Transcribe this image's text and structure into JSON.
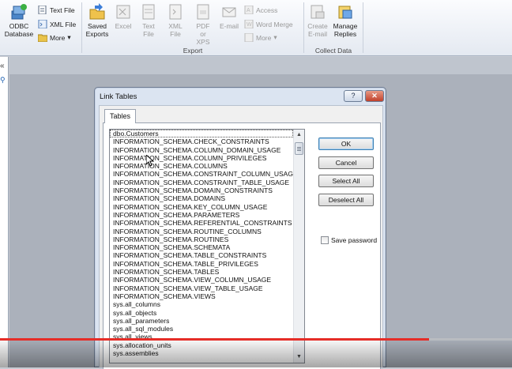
{
  "ribbon": {
    "import_group": {
      "odbc_label": "ODBC Database",
      "text_file": "Text File",
      "xml_file": "XML File",
      "more": "More"
    },
    "export_group": {
      "saved_exports": "Saved Exports",
      "excel": "Excel",
      "text_file": "Text File",
      "xml_file": "XML File",
      "pdf_xps": "PDF or XPS",
      "email": "E-mail",
      "access": "Access",
      "word_merge": "Word Merge",
      "more": "More",
      "label": "Export"
    },
    "collect_group": {
      "create_email": "Create E-mail",
      "manage_replies": "Manage Replies",
      "label": "Collect Data"
    }
  },
  "nav": {
    "collapse_glyph": "«",
    "search_glyph": "⚲"
  },
  "dialog": {
    "title": "Link Tables",
    "help_glyph": "?",
    "close_glyph": "✕",
    "tab": "Tables",
    "tables": [
      "dbo.Customers",
      "INFORMATION_SCHEMA.CHECK_CONSTRAINTS",
      "INFORMATION_SCHEMA.COLUMN_DOMAIN_USAGE",
      "INFORMATION_SCHEMA.COLUMN_PRIVILEGES",
      "INFORMATION_SCHEMA.COLUMNS",
      "INFORMATION_SCHEMA.CONSTRAINT_COLUMN_USAGE",
      "INFORMATION_SCHEMA.CONSTRAINT_TABLE_USAGE",
      "INFORMATION_SCHEMA.DOMAIN_CONSTRAINTS",
      "INFORMATION_SCHEMA.DOMAINS",
      "INFORMATION_SCHEMA.KEY_COLUMN_USAGE",
      "INFORMATION_SCHEMA.PARAMETERS",
      "INFORMATION_SCHEMA.REFERENTIAL_CONSTRAINTS",
      "INFORMATION_SCHEMA.ROUTINE_COLUMNS",
      "INFORMATION_SCHEMA.ROUTINES",
      "INFORMATION_SCHEMA.SCHEMATA",
      "INFORMATION_SCHEMA.TABLE_CONSTRAINTS",
      "INFORMATION_SCHEMA.TABLE_PRIVILEGES",
      "INFORMATION_SCHEMA.TABLES",
      "INFORMATION_SCHEMA.VIEW_COLUMN_USAGE",
      "INFORMATION_SCHEMA.VIEW_TABLE_USAGE",
      "INFORMATION_SCHEMA.VIEWS",
      "sys.all_columns",
      "sys.all_objects",
      "sys.all_parameters",
      "sys.all_sql_modules",
      "sys.all_views",
      "sys.allocation_units",
      "sys.assemblies"
    ],
    "buttons": {
      "ok": "OK",
      "cancel": "Cancel",
      "select_all": "Select All",
      "deselect_all": "Deselect All"
    },
    "save_password": "Save password",
    "save_password_checked": false
  },
  "video": {
    "progress": 0.838,
    "progress_color": "#e52d27"
  }
}
